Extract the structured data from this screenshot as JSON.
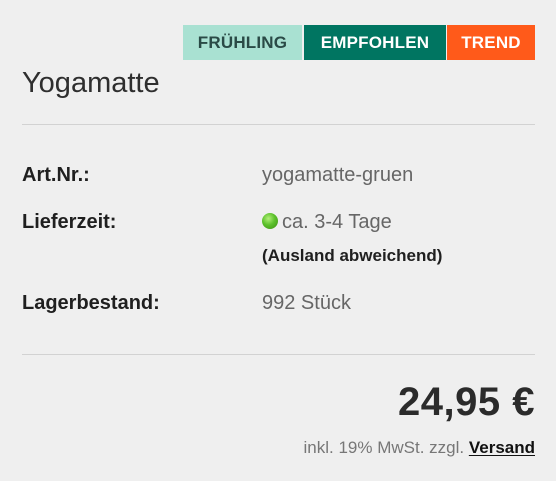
{
  "badges": {
    "spring": "FRÜHLING",
    "recommended": "EMPFOHLEN",
    "trend": "TREND"
  },
  "product": {
    "title": "Yogamatte"
  },
  "details": {
    "art_nr_label": "Art.Nr.:",
    "art_nr_value": "yogamatte-gruen",
    "delivery_label": "Lieferzeit:",
    "delivery_value": "ca. 3-4 Tage",
    "delivery_note": "(Ausland abweichend)",
    "stock_label": "Lagerbestand:",
    "stock_value": "992 Stück"
  },
  "pricing": {
    "price": "24,95 €",
    "tax_text": "inkl. 19% MwSt. zzgl.",
    "shipping_link": "Versand"
  },
  "colors": {
    "badge_spring": "#a9e1d2",
    "badge_recommended": "#007561",
    "badge_trend": "#ff5a1a",
    "availability_dot": "#5cc12b"
  },
  "icons": {
    "availability": "green-status-dot-icon"
  }
}
